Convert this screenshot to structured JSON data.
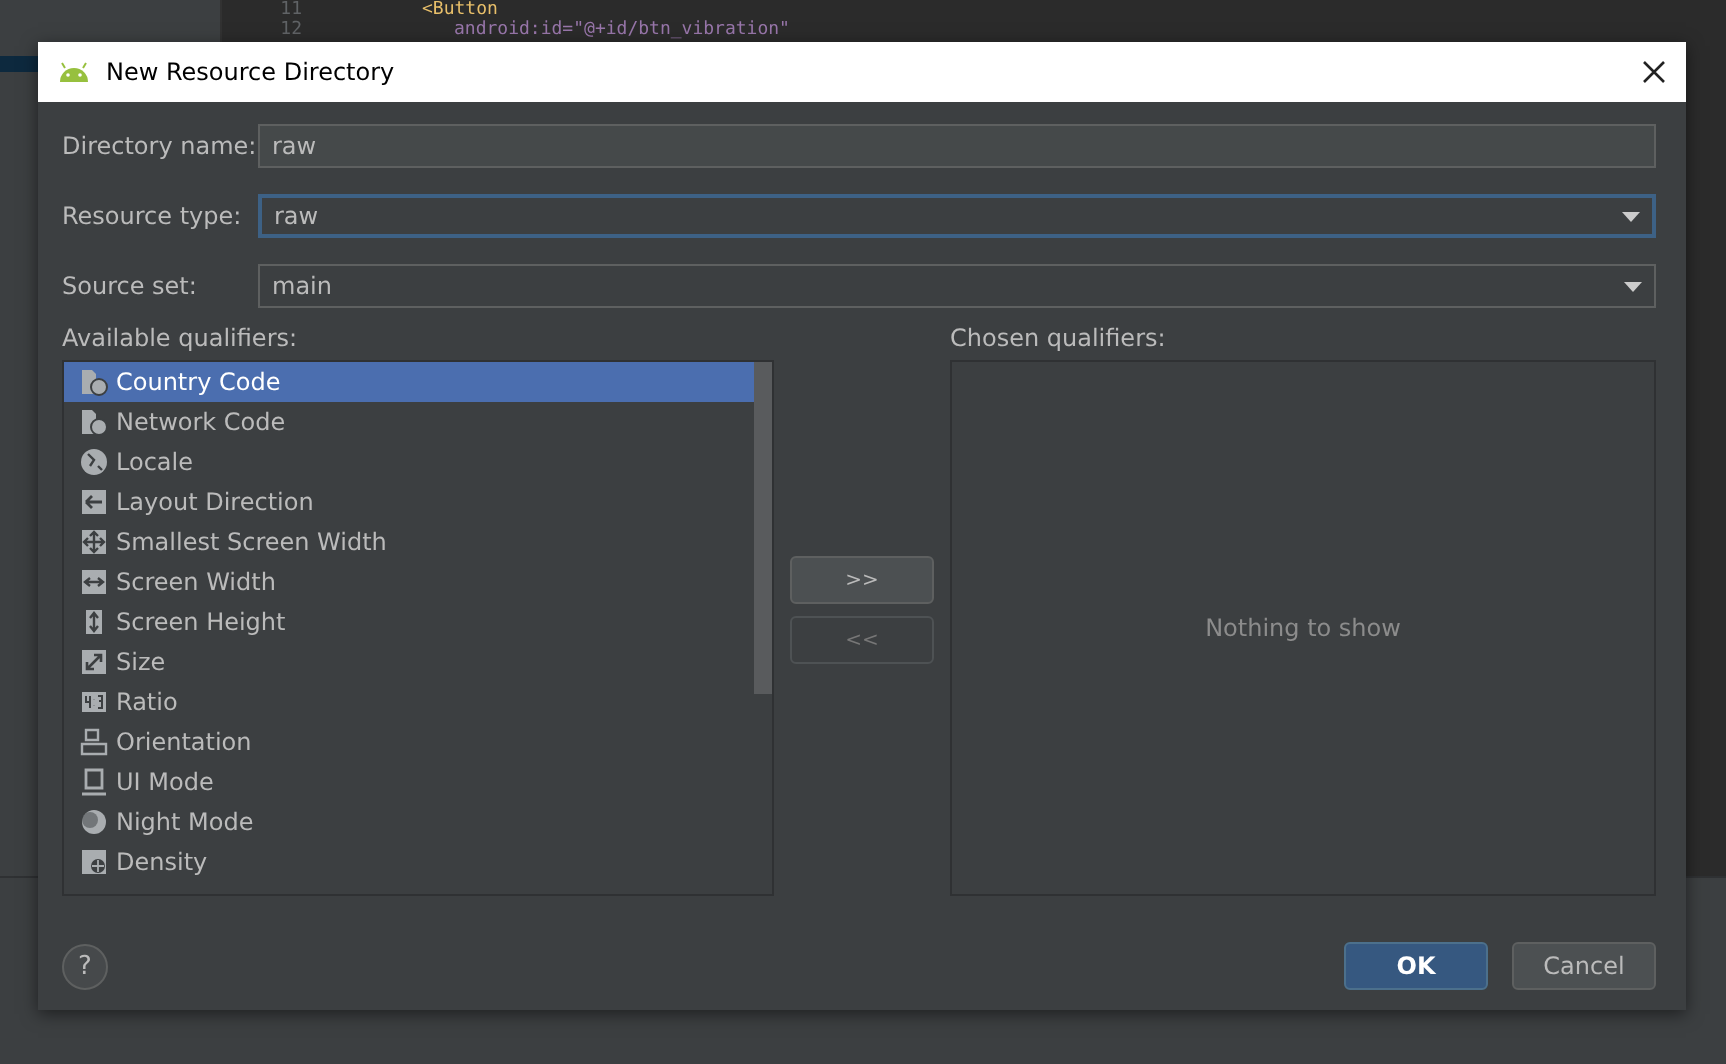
{
  "editor": {
    "lines": [
      {
        "number": "11",
        "code": "<Button"
      },
      {
        "number": "12",
        "code": "android:id=\"@+id/btn_vibration\""
      }
    ]
  },
  "dialog": {
    "title": "New Resource Directory",
    "fields": [
      {
        "label": "Directory name:",
        "value": "raw",
        "kind": "text",
        "focused": false
      },
      {
        "label": "Resource type:",
        "value": "raw",
        "kind": "dropdown",
        "focused": true
      },
      {
        "label": "Source set:",
        "value": "main",
        "kind": "dropdown",
        "focused": false
      }
    ],
    "available": {
      "label": "Available qualifiers:",
      "items": [
        {
          "label": "Country Code",
          "selected": true
        },
        {
          "label": "Network Code",
          "selected": false
        },
        {
          "label": "Locale",
          "selected": false
        },
        {
          "label": "Layout Direction",
          "selected": false
        },
        {
          "label": "Smallest Screen Width",
          "selected": false
        },
        {
          "label": "Screen Width",
          "selected": false
        },
        {
          "label": "Screen Height",
          "selected": false
        },
        {
          "label": "Size",
          "selected": false
        },
        {
          "label": "Ratio",
          "selected": false
        },
        {
          "label": "Orientation",
          "selected": false
        },
        {
          "label": "UI Mode",
          "selected": false
        },
        {
          "label": "Night Mode",
          "selected": false
        },
        {
          "label": "Density",
          "selected": false
        }
      ]
    },
    "move_buttons": [
      {
        "label": ">>",
        "disabled": false
      },
      {
        "label": "<<",
        "disabled": true
      }
    ],
    "chosen": {
      "label": "Chosen qualifiers:",
      "empty_text": "Nothing to show"
    },
    "help": "?",
    "buttons": [
      {
        "label": "OK",
        "kind": "primary"
      },
      {
        "label": "Cancel",
        "kind": "secondary"
      }
    ]
  }
}
